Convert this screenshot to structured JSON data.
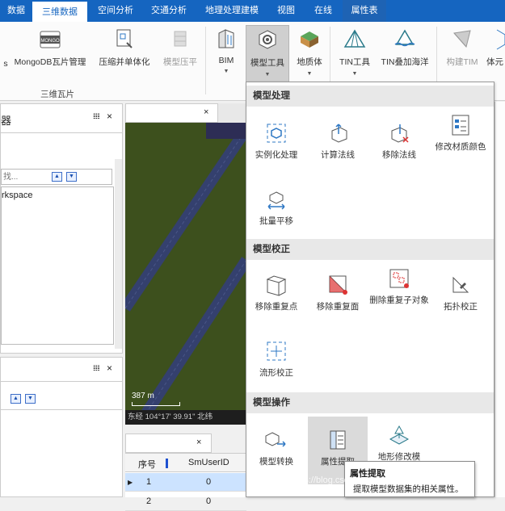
{
  "menu": {
    "tabs": [
      {
        "label": "数据"
      },
      {
        "label": "三维数据"
      },
      {
        "label": "空间分析"
      },
      {
        "label": "交通分析"
      },
      {
        "label": "地理处理建模"
      },
      {
        "label": "视图"
      },
      {
        "label": "在线"
      },
      {
        "label": "属性表"
      }
    ]
  },
  "ribbon": {
    "mongodb": "MongoDB瓦片管理",
    "compress": "压缩并单体化",
    "flatten": "模型压平",
    "bim": "BIM",
    "model_tools": "模型工具",
    "geobody": "地质体",
    "tin_tools": "TIN工具",
    "tin_ocean": "TIN叠加海洋",
    "build_tin": "构建TIM",
    "body_partial": "体元",
    "group_label": "三维瓦片"
  },
  "left_panel_top": {
    "title": "器",
    "pin": "𝍖",
    "close": "×",
    "search_placeholder": "找...",
    "tree_item": "rkspace"
  },
  "left_panel_bottom": {
    "pin": "𝍖",
    "close": "×"
  },
  "map": {
    "tab_close": "×",
    "scale": "387 m",
    "coords": "东经 104°17' 39.91\"  北纬"
  },
  "table": {
    "tab_close": "×",
    "headers": [
      "序号",
      "SmUserID"
    ],
    "rows": [
      {
        "index": "1",
        "value": "0"
      },
      {
        "index": "2",
        "value": "0"
      }
    ]
  },
  "dropdown": {
    "sections": [
      {
        "title": "模型处理"
      },
      {
        "title": "模型校正"
      },
      {
        "title": "模型操作"
      }
    ],
    "items": {
      "instancing": "实例化处理",
      "calc_normals": "计算法线",
      "remove_normals": "移除法线",
      "modify_material": "修改材质颜色",
      "batch_translate": "批量平移",
      "remove_dup_points": "移除重复点",
      "remove_dup_faces": "移除重复面",
      "remove_dup_subobjects": "删除重复子对象",
      "topology_correct": "拓扑校正",
      "manifold_correct": "流形校正",
      "model_convert": "模型转换",
      "attr_extract": "属性提取",
      "terrain_modify": "地形修改模"
    }
  },
  "tooltip": {
    "title": "属性提取",
    "desc": "提取模型数据集的相关属性。"
  },
  "watermark": "https://blog.csdn.net/supermapsupport/100",
  "colors": {
    "menubar": "#1565c0",
    "map_ground": "#3d501d",
    "road": "#34406e",
    "icon_blue": "#2f78c4"
  }
}
